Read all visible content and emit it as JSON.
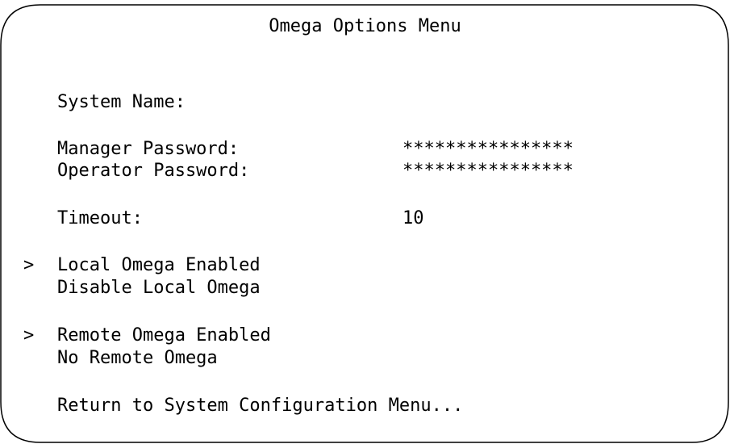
{
  "screen": {
    "title": "Omega Options Menu"
  },
  "fields": {
    "system_name_label": "System Name:",
    "system_name_value": "",
    "manager_password_label": "Manager Password:",
    "manager_password_value": "****************",
    "operator_password_label": "Operator Password:",
    "operator_password_value": "****************",
    "timeout_label": "Timeout:",
    "timeout_value": "10"
  },
  "local_omega": {
    "marker": ">",
    "enabled_label": "Local Omega Enabled",
    "disable_label": "Disable Local Omega"
  },
  "remote_omega": {
    "marker": ">",
    "enabled_label": "Remote Omega Enabled",
    "disable_label": "No Remote Omega"
  },
  "footer": {
    "return_label": "Return to System Configuration Menu..."
  },
  "colors": {
    "background": "#ffffff",
    "text": "#000000",
    "border": "#000000"
  }
}
